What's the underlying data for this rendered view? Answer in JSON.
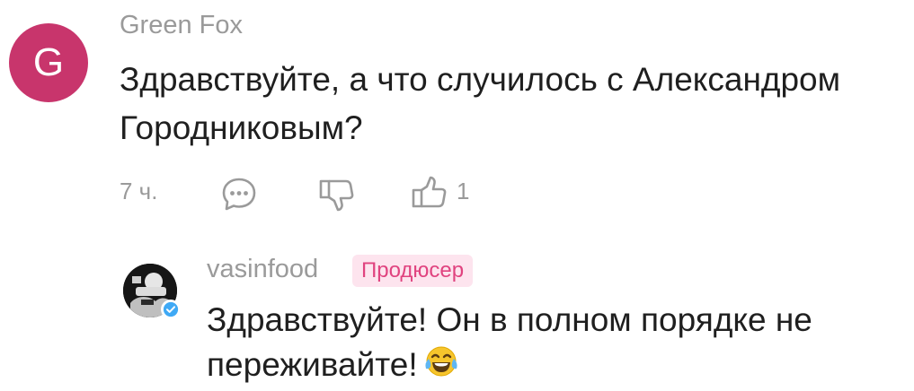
{
  "comment": {
    "author": "Green Fox",
    "avatar_letter": "G",
    "avatar_color": "#c8356c",
    "text": "Здравствуйте, а что случилось с Александром Городниковым?",
    "time": "7 ч.",
    "likes": "1",
    "icons": [
      "reply-icon",
      "dislike-icon",
      "like-icon"
    ]
  },
  "reply": {
    "author": "vasinfood",
    "badge": "Продюсер",
    "badge_color": "#e0437f",
    "text": "Здравствуйте! Он в полном порядке не переживайте!",
    "emoji": "face-with-tears-of-joy-icon",
    "verified": "verified-badge-icon"
  }
}
